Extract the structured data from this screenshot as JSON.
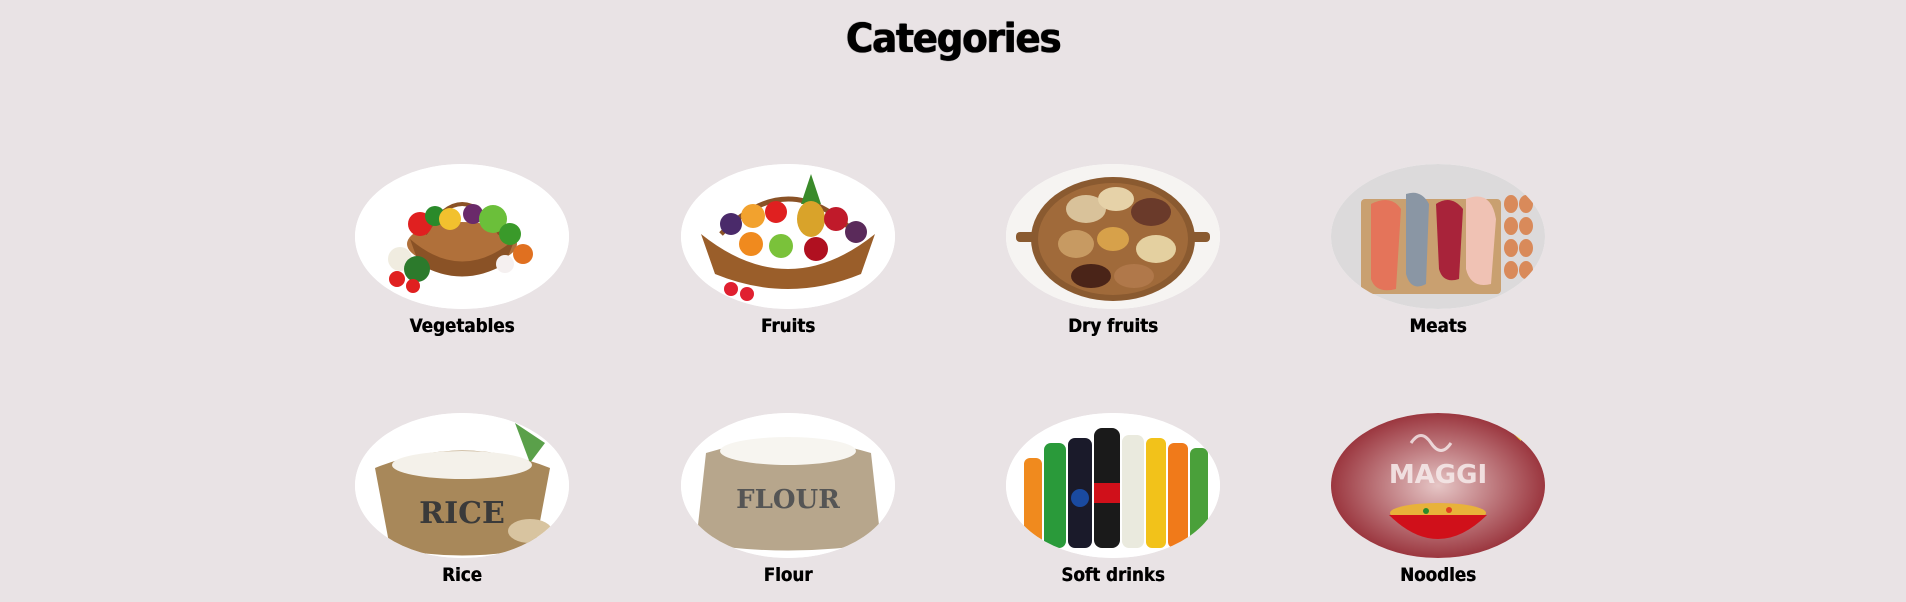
{
  "page": {
    "title": "Categories",
    "background": "#e9e3e5"
  },
  "categories": [
    {
      "label": "Vegetables",
      "icon": "vegetable-basket-image"
    },
    {
      "label": "Fruits",
      "icon": "fruit-basket-image"
    },
    {
      "label": "Dry fruits",
      "icon": "dry-fruits-tray-image"
    },
    {
      "label": "Meats",
      "icon": "meats-board-image"
    },
    {
      "label": "Rice",
      "icon": "rice-sack-image"
    },
    {
      "label": "Flour",
      "icon": "flour-sack-image"
    },
    {
      "label": "Soft drinks",
      "icon": "soft-drink-bottles-image"
    },
    {
      "label": "Noodles",
      "icon": "noodles-bowl-image",
      "brand_text": "MAGGI"
    }
  ]
}
